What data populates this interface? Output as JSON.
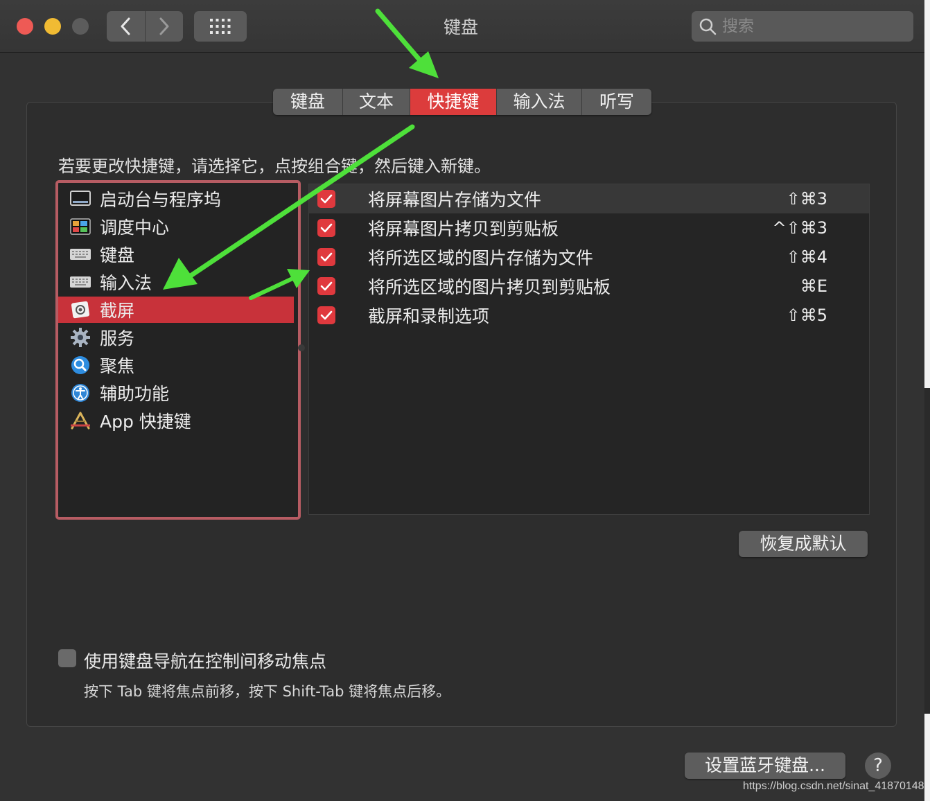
{
  "window": {
    "title": "键盘"
  },
  "search": {
    "placeholder": "搜索"
  },
  "tabs": [
    {
      "label": "键盘",
      "active": false
    },
    {
      "label": "文本",
      "active": false
    },
    {
      "label": "快捷键",
      "active": true
    },
    {
      "label": "输入法",
      "active": false
    },
    {
      "label": "听写",
      "active": false
    }
  ],
  "instruction": "若要更改快捷键，请选择它，点按组合键，然后键入新键。",
  "categories": [
    {
      "label": "启动台与程序坞",
      "icon": "dock-icon"
    },
    {
      "label": "调度中心",
      "icon": "mission-control-icon"
    },
    {
      "label": "键盘",
      "icon": "keyboard-icon"
    },
    {
      "label": "输入法",
      "icon": "input-source-icon"
    },
    {
      "label": "截屏",
      "icon": "screenshot-icon",
      "selected": true
    },
    {
      "label": "服务",
      "icon": "gear-icon"
    },
    {
      "label": "聚焦",
      "icon": "spotlight-icon"
    },
    {
      "label": "辅助功能",
      "icon": "accessibility-icon"
    },
    {
      "label": "App 快捷键",
      "icon": "app-store-icon"
    }
  ],
  "shortcuts": [
    {
      "label": "将屏幕图片存储为文件",
      "keys": "⇧⌘3",
      "checked": true
    },
    {
      "label": "将屏幕图片拷贝到剪贴板",
      "keys": "^⇧⌘3",
      "checked": true
    },
    {
      "label": "将所选区域的图片存储为文件",
      "keys": "⇧⌘4",
      "checked": true
    },
    {
      "label": "将所选区域的图片拷贝到剪贴板",
      "keys": "⌘E",
      "checked": true
    },
    {
      "label": "截屏和录制选项",
      "keys": "⇧⌘5",
      "checked": true
    }
  ],
  "buttons": {
    "restore_defaults": "恢复成默认",
    "bluetooth_keyboard": "设置蓝牙键盘...",
    "help": "?"
  },
  "keyboard_navigation": {
    "label": "使用键盘导航在控制间移动焦点",
    "description": "按下 Tab 键将焦点前移，按下 Shift-Tab 键将焦点后移。",
    "checked": false
  },
  "watermark": "https://blog.csdn.net/sinat_41870148",
  "colors": {
    "accent": "#dc3c3c",
    "annotation_arrow": "#4ee03a"
  }
}
